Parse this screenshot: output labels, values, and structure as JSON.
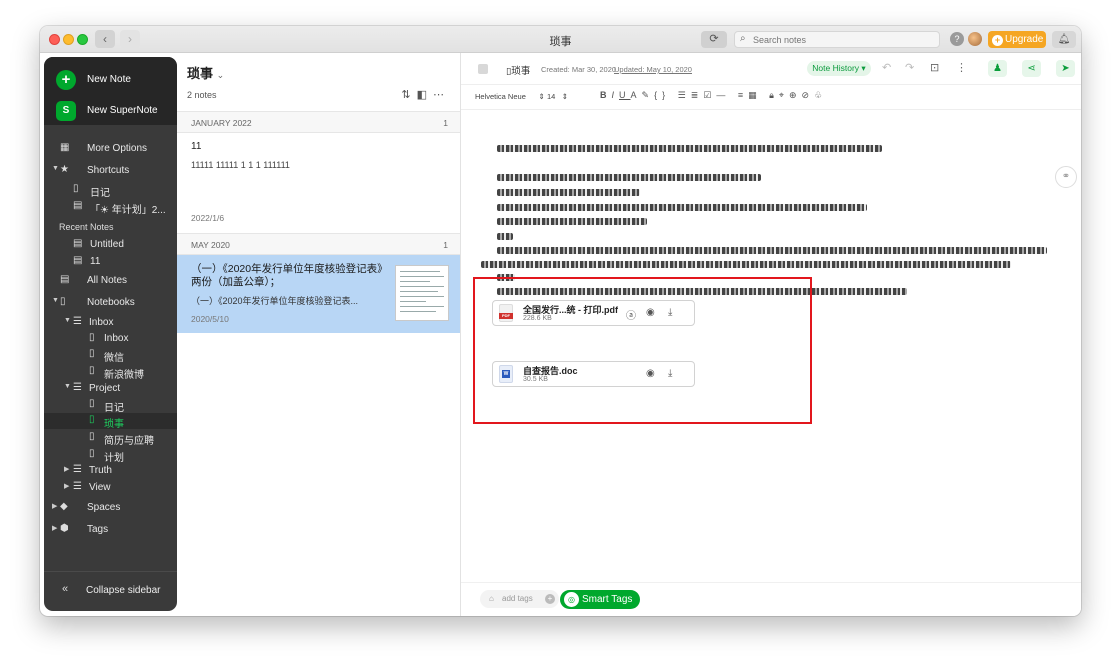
{
  "window": {
    "title": "琐事",
    "search_placeholder": "Search notes",
    "upgrade_label": "Upgrade"
  },
  "sidebar": {
    "new_note": "New Note",
    "new_supernote": "New SuperNote",
    "more_options": "More Options",
    "shortcuts": "Shortcuts",
    "shortcut_items": [
      "日记",
      "「☀ 年计划」2..."
    ],
    "recent_notes_header": "Recent Notes",
    "recent_items": [
      "Untitled",
      "11"
    ],
    "all_notes": "All Notes",
    "notebooks": "Notebooks",
    "inbox_stack": "Inbox",
    "inbox_items": [
      "Inbox",
      "微信",
      "新浪微博"
    ],
    "project_stack": "Project",
    "project_items": [
      "日记",
      "琐事",
      "简历与应聘",
      "计划"
    ],
    "truth": "Truth",
    "view": "View",
    "spaces": "Spaces",
    "tags": "Tags",
    "collapse": "Collapse sidebar"
  },
  "notelist": {
    "title": "琐事",
    "count": "2 notes",
    "groups": [
      {
        "label": "JANUARY 2022",
        "count": "1",
        "note": {
          "title": "11",
          "snippet": "11111 11111 1 1 1 111111",
          "date": "2022/1/6"
        }
      },
      {
        "label": "MAY 2020",
        "count": "1",
        "note": {
          "title": "（一）《2020年发行单位年度核验登记表》两份（加盖公章）；",
          "snippet": "（一）《2020年发行单位年度核验登记表...",
          "date": "2020/5/10"
        }
      }
    ]
  },
  "editor": {
    "notebook": "琐事",
    "created": "Created: Mar 30, 2020",
    "updated": "Updated: May 10, 2020",
    "note_history": "Note History",
    "font": "Helvetica Neue",
    "size": "14",
    "attachments": [
      {
        "name": "全国发行...统 - 打印.pdf",
        "size": "228.6 KB",
        "type": "pdf",
        "type_label": "PDF"
      },
      {
        "name": "自查报告.doc",
        "size": "30.5 KB",
        "type": "doc",
        "type_label": "W"
      }
    ],
    "add_tags": "add tags",
    "smart_tags": "Smart Tags"
  },
  "colors": {
    "accent": "#00a82d",
    "selection": "#b8d6f5",
    "highlight_box": "#e2171d",
    "upgrade": "#f5a623"
  }
}
